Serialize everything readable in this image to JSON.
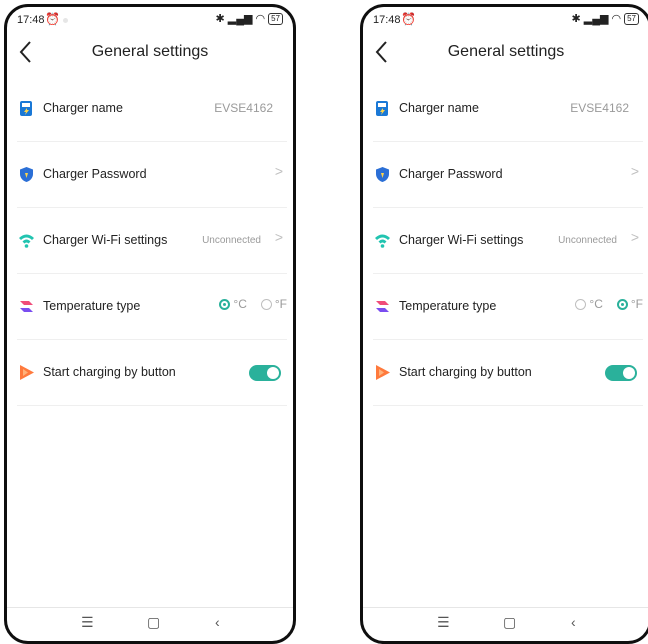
{
  "screens": [
    {
      "status": {
        "time": "17:48",
        "battery": "57"
      },
      "header": {
        "title": "General settings"
      },
      "rows": {
        "charger_name": {
          "label": "Charger name",
          "value": "EVSE4162"
        },
        "charger_password": {
          "label": "Charger Password",
          "chevron": ">"
        },
        "wifi": {
          "label": "Charger Wi-Fi settings",
          "value": "Unconnected",
          "chevron": ">"
        },
        "temperature": {
          "label": "Temperature type",
          "option_c": "°C",
          "option_f": "°F",
          "selected": "°C"
        },
        "start_button": {
          "label": "Start charging by button",
          "enabled": true
        }
      }
    },
    {
      "status": {
        "time": "17:48",
        "battery": "57"
      },
      "header": {
        "title": "General settings"
      },
      "rows": {
        "charger_name": {
          "label": "Charger name",
          "value": "EVSE4162"
        },
        "charger_password": {
          "label": "Charger Password",
          "chevron": ">"
        },
        "wifi": {
          "label": "Charger Wi-Fi settings",
          "value": "Unconnected",
          "chevron": ">"
        },
        "temperature": {
          "label": "Temperature type",
          "option_c": "°C",
          "option_f": "°F",
          "selected": "°F"
        },
        "start_button": {
          "label": "Start charging by button",
          "enabled": true
        }
      }
    }
  ],
  "colors": {
    "accent": "#2ab19b",
    "charger_icon": "#1a78d6",
    "shield_icon": "#2b6fd6",
    "wifi_icon": "#21c4b0",
    "temp_icon_top": "#f04c7a",
    "temp_icon_bottom": "#7a4df0",
    "play_icon": "#ff7a3d"
  },
  "icons": [
    "charger-icon",
    "shield-icon",
    "wifi-icon",
    "temperature-icon",
    "play-icon",
    "back-arrow-icon",
    "alarm-icon",
    "bluetooth-icon",
    "signal-icon",
    "wifi-status-icon",
    "battery-icon",
    "menu-icon",
    "home-icon",
    "back-icon"
  ]
}
